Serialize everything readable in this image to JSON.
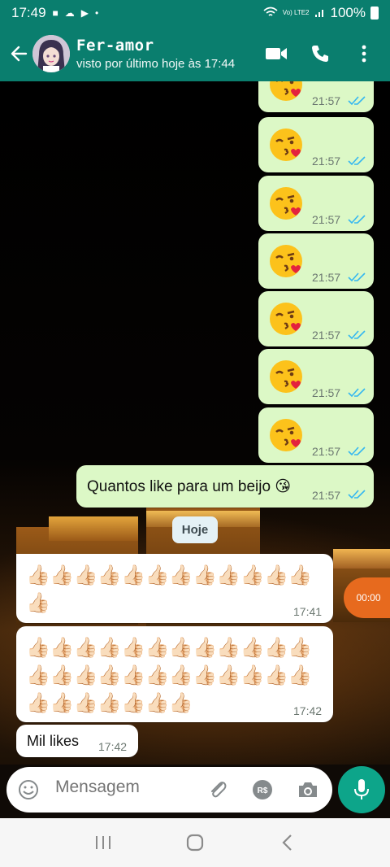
{
  "status_bar": {
    "time": "17:49",
    "battery": "100%",
    "network": "Vo) LTE2"
  },
  "header": {
    "contact_name": "Fer-amor",
    "last_seen": "visto por último hoje às 17:44"
  },
  "messages_sent": [
    {
      "emoji": "😘",
      "time": "21:57"
    },
    {
      "emoji": "😘",
      "time": "21:57"
    },
    {
      "emoji": "😘",
      "time": "21:57"
    },
    {
      "emoji": "😘",
      "time": "21:57"
    },
    {
      "emoji": "😘",
      "time": "21:57"
    },
    {
      "emoji": "😘",
      "time": "21:57"
    },
    {
      "emoji": "😘",
      "time": "21:57"
    }
  ],
  "question": {
    "text": "Quantos like para um beijo 😘",
    "time": "21:57"
  },
  "date_divider": "Hoje",
  "received": [
    {
      "thumbs": 13,
      "time": "17:41"
    },
    {
      "thumbs": 31,
      "time": "17:42"
    },
    {
      "text": "Mil likes",
      "time": "17:42"
    }
  ],
  "voice_overlay": "00:00",
  "input": {
    "placeholder": "Mensagem"
  },
  "icons": [
    "back-arrow-icon",
    "video-call-icon",
    "phone-icon",
    "more-options-icon",
    "emoji-icon",
    "attach-icon",
    "payment-icon",
    "camera-icon",
    "mic-icon",
    "recent-apps-icon",
    "home-icon",
    "back-icon"
  ],
  "colors": {
    "header": "#0a7e6e",
    "outgoing_bubble": "#dcf8c6",
    "incoming_bubble": "#ffffff",
    "read_ticks": "#34b7f1",
    "mic_button": "#0da58a"
  }
}
